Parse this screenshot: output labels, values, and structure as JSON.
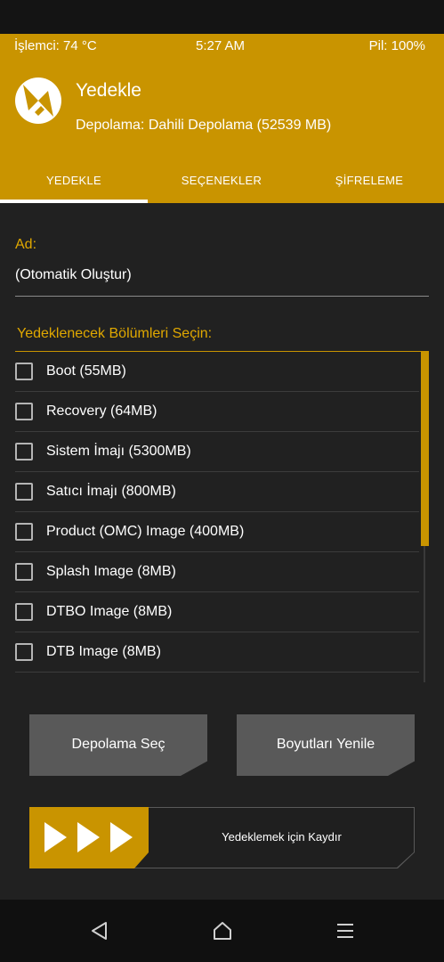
{
  "status_bar": {
    "cpu": "İşlemci: 74 °C",
    "time": "5:27 AM",
    "battery": "Pil: 100%"
  },
  "header": {
    "title": "Yedekle",
    "storage": "Depolama: Dahili Depolama (52539 MB)",
    "logo_icon": "twrp-logo-icon",
    "tabs": [
      {
        "label": "YEDEKLE",
        "active": true
      },
      {
        "label": "SEÇENEKLER",
        "active": false
      },
      {
        "label": "ŞİFRELEME",
        "active": false
      }
    ]
  },
  "name_field": {
    "label": "Ad:",
    "value": "(Otomatik Oluştur)"
  },
  "partitions": {
    "label": "Yedeklenecek Bölümleri Seçin:",
    "items": [
      {
        "label": "Boot (55MB)",
        "checked": false
      },
      {
        "label": "Recovery (64MB)",
        "checked": false
      },
      {
        "label": "Sistem İmajı (5300MB)",
        "checked": false
      },
      {
        "label": "Satıcı İmajı (800MB)",
        "checked": false
      },
      {
        "label": "Product (OMC) Image (400MB)",
        "checked": false
      },
      {
        "label": "Splash Image (8MB)",
        "checked": false
      },
      {
        "label": "DTBO Image (8MB)",
        "checked": false
      },
      {
        "label": "DTB Image (8MB)",
        "checked": false
      }
    ]
  },
  "buttons": {
    "select_storage": "Depolama Seç",
    "refresh_sizes": "Boyutları Yenile"
  },
  "slider": {
    "label": "Yedeklemek için Kaydır",
    "icon": "triple-arrow-icon"
  },
  "nav": {
    "back_icon": "back-triangle-icon",
    "home_icon": "home-icon",
    "menu_icon": "menu-icon"
  },
  "colors": {
    "accent": "#c99400",
    "background": "#212121",
    "button": "#595959"
  }
}
